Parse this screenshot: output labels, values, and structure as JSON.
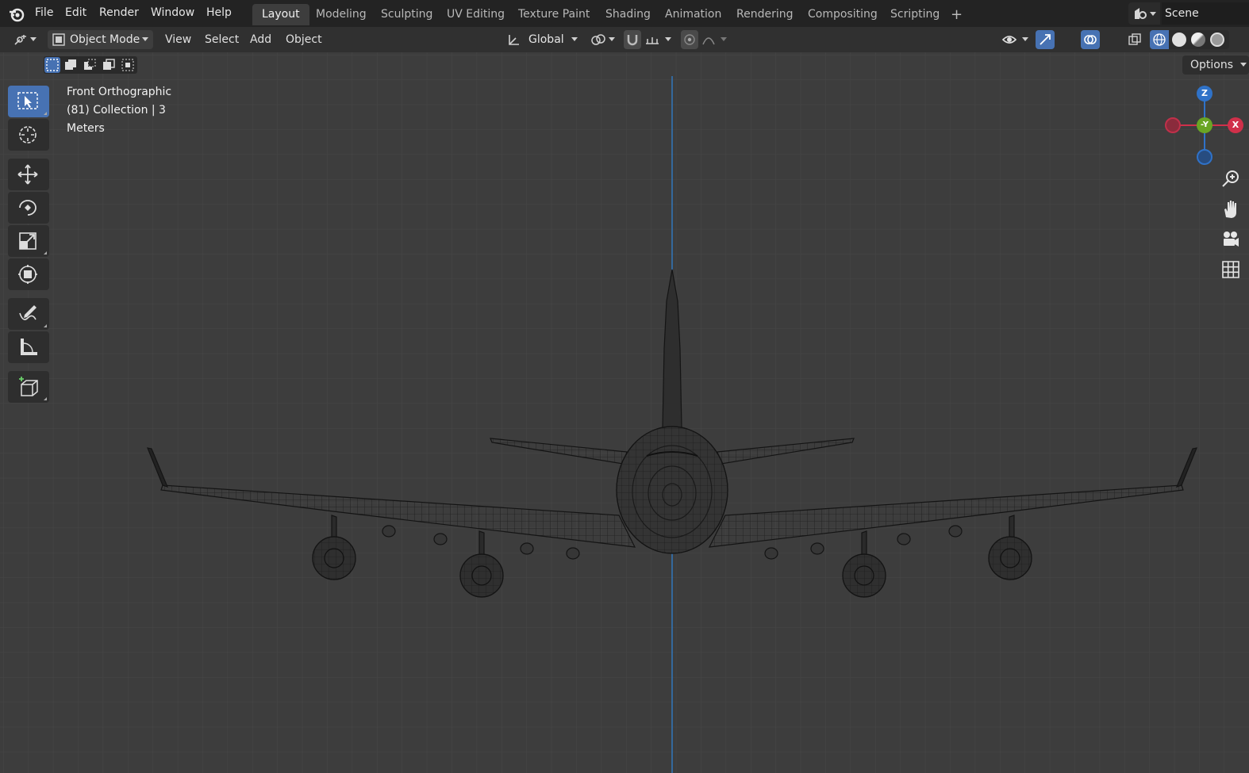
{
  "top_menu": [
    "File",
    "Edit",
    "Render",
    "Window",
    "Help"
  ],
  "workspace_tabs": [
    {
      "label": "Layout",
      "active": true
    },
    {
      "label": "Modeling",
      "active": false
    },
    {
      "label": "Sculpting",
      "active": false
    },
    {
      "label": "UV Editing",
      "active": false
    },
    {
      "label": "Texture Paint",
      "active": false
    },
    {
      "label": "Shading",
      "active": false
    },
    {
      "label": "Animation",
      "active": false
    },
    {
      "label": "Rendering",
      "active": false
    },
    {
      "label": "Compositing",
      "active": false
    },
    {
      "label": "Scripting",
      "active": false
    }
  ],
  "add_workspace_symbol": "+",
  "scene": {
    "name": "Scene",
    "icon": "scene-icon"
  },
  "header": {
    "mode": "Object Mode",
    "menus": [
      "View",
      "Select",
      "Add",
      "Object"
    ],
    "transform_orientation": "Global",
    "options_label": "Options"
  },
  "viewport": {
    "view_name": "Front Orthographic",
    "collection_info": "(81) Collection | 3",
    "units": "Meters",
    "background_color": "#3d3d3d",
    "z_axis_color": "#2f7fd0"
  },
  "gizmo": {
    "z_label": "Z",
    "y_label": "-Y",
    "x_label": "X",
    "x_color": "#d0304a",
    "y_color": "#6aa524",
    "z_color": "#2f72c8"
  },
  "tools": [
    {
      "name": "select-box-tool",
      "icon": "select-box-icon",
      "active": true
    },
    {
      "name": "cursor-tool",
      "icon": "cursor-icon",
      "active": false
    },
    {
      "name": "move-tool",
      "icon": "move-icon",
      "active": false
    },
    {
      "name": "rotate-tool",
      "icon": "rotate-icon",
      "active": false
    },
    {
      "name": "scale-tool",
      "icon": "scale-icon",
      "active": false
    },
    {
      "name": "transform-tool",
      "icon": "transform-icon",
      "active": false
    },
    {
      "name": "annotate-tool",
      "icon": "annotate-icon",
      "active": false
    },
    {
      "name": "measure-tool",
      "icon": "measure-icon",
      "active": false
    },
    {
      "name": "add-cube-tool",
      "icon": "add-cube-icon",
      "active": false
    }
  ],
  "nav_icons": [
    "zoom-icon",
    "hand-pan-icon",
    "camera-icon",
    "grid-toggle-icon"
  ],
  "accent_color": "#4772b3"
}
